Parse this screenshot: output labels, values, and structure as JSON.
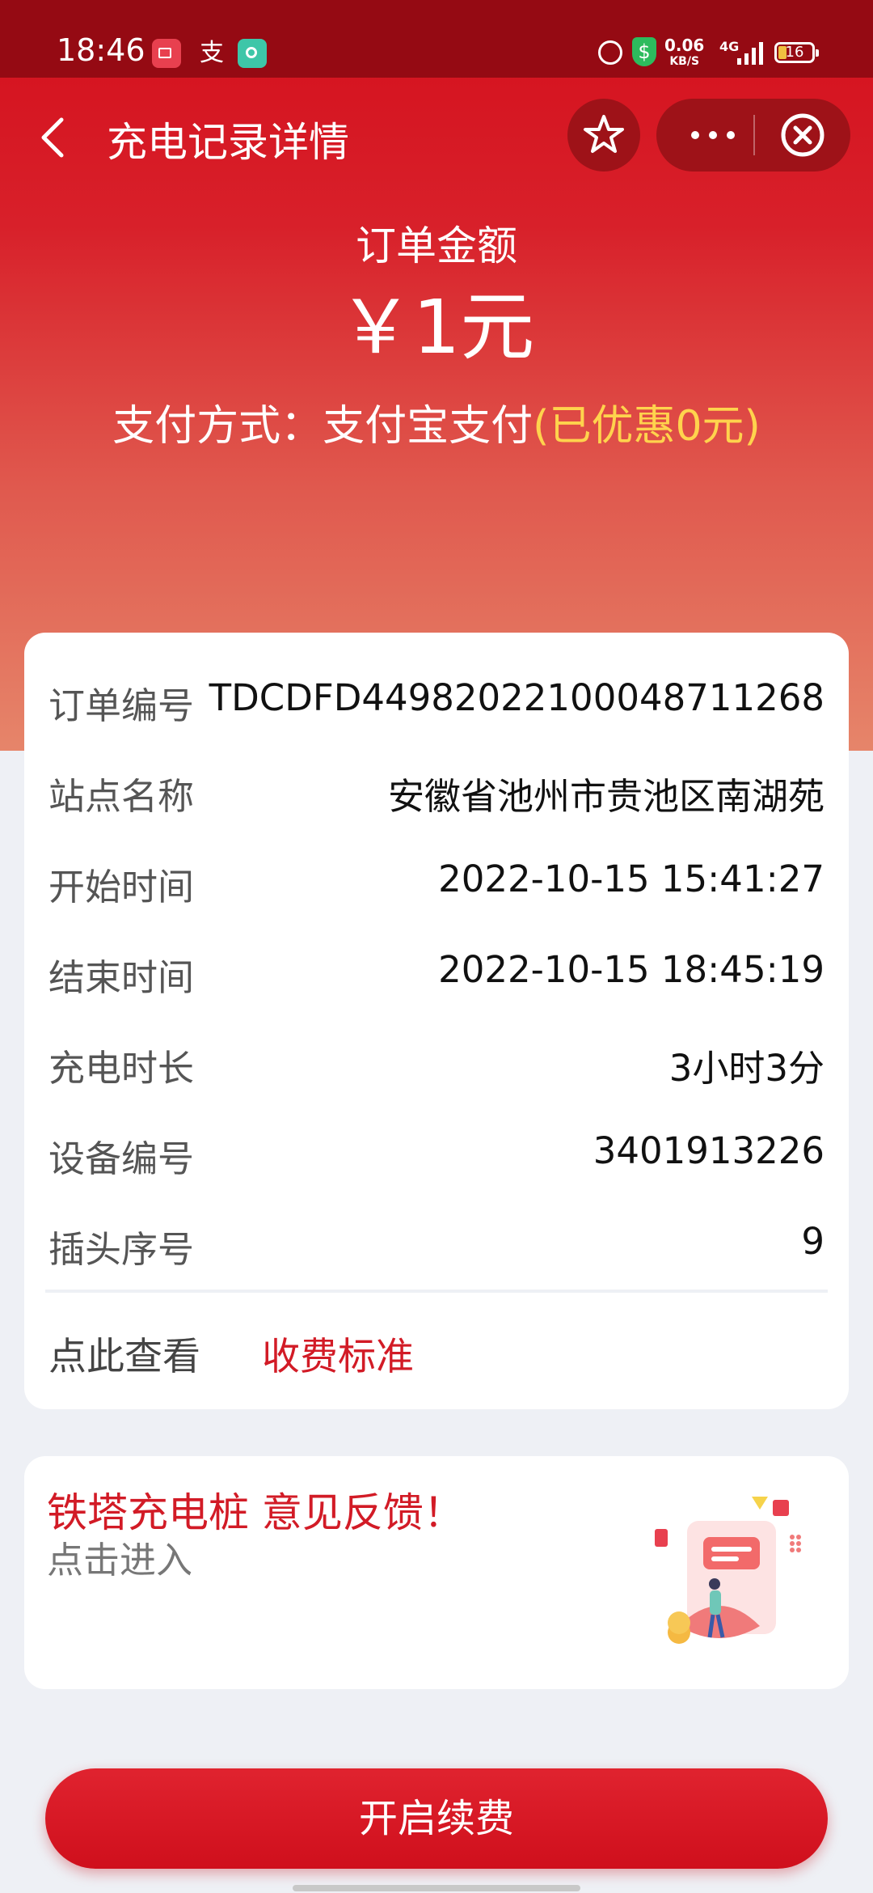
{
  "status_bar": {
    "time": "18:46",
    "speed_value": "0.06",
    "speed_unit": "KB/S",
    "network": "4G",
    "battery": "16",
    "left_icons": [
      "video-recorder-icon",
      "alipay-icon",
      "music-icon"
    ],
    "right_icons": [
      "alarm-icon",
      "security-shield-icon",
      "signal-icon",
      "battery-icon"
    ]
  },
  "nav": {
    "title": "充电记录详情",
    "icons": [
      "back-icon",
      "favorite-star-icon",
      "more-dots-icon",
      "close-circle-icon"
    ]
  },
  "summary": {
    "amount_label": "订单金额",
    "amount_value": "￥1元",
    "pay_label": "支付方式：支付宝支付",
    "pay_discount": "(已优惠0元)"
  },
  "details": [
    {
      "label": "订单编号",
      "value": "TDCDFD4498202210004871​1268"
    },
    {
      "label": "站点名称",
      "value": "安徽省池州市贵池区南湖苑"
    },
    {
      "label": "开始时间",
      "value": "2022-10-15 15:41:27"
    },
    {
      "label": "结束时间",
      "value": "2022-10-15 18:45:19"
    },
    {
      "label": "充电时长",
      "value": "3小时3分"
    },
    {
      "label": "设备编号",
      "value": "3401913226"
    },
    {
      "label": "插头序号",
      "value": "9"
    }
  ],
  "fee": {
    "label": "点此查看",
    "link": "收费标准"
  },
  "feedback": {
    "title": "铁塔充电桩 意见反馈！",
    "subtitle": "点击进入"
  },
  "renew_button": "开启续费",
  "colors": {
    "brand_red": "#d21b26",
    "status_bar": "#950a13",
    "discount_yellow": "#ffd34d"
  }
}
